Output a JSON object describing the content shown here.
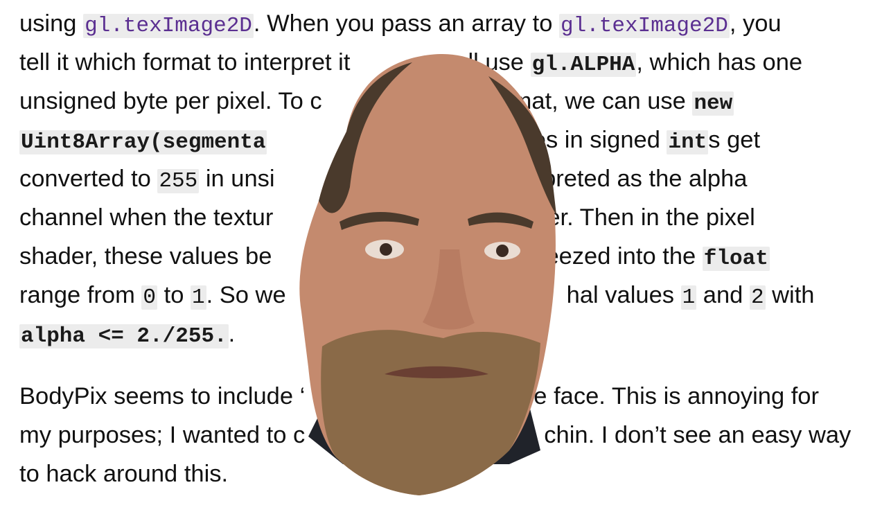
{
  "article": {
    "para1": {
      "l1": {
        "t1": "using ",
        "c1": "gl.texImage2D",
        "t2": ". When you pass an array to ",
        "c2": "gl.texImage2D",
        "t3": ", you"
      },
      "l2": {
        "t1": "tell it which format to interpret it",
        "t2": "ll use ",
        "c1": "gl.ALPHA",
        "t3": ", which has one"
      },
      "l3": {
        "t1": "unsigned byte per pixel. To c",
        "t2": "mat, we can use ",
        "c1": "new"
      },
      "l4": {
        "c1": "Uint8Array(segmenta",
        "t1": "values in signed ",
        "c2": "int",
        "t2": "s get"
      },
      "l5": {
        "t1": "converted to ",
        "c1": "255",
        "t2": " in unsi",
        "t3": "rpreted as the alpha"
      },
      "l6": {
        "t1": "channel when the textur",
        "t2": "er. Then in the pixel"
      },
      "l7": {
        "t1": "shader, these values be",
        "t2": "eezed into the ",
        "c1": "float"
      },
      "l8": {
        "t1": "range from ",
        "c1": "0",
        "t2": " to ",
        "c2": "1",
        "t3": ". So we",
        "t4": "hal values ",
        "c3": "1",
        "t5": " and ",
        "c4": "2",
        "t6": " with"
      },
      "l9": {
        "c1": "alpha <= 2./255.",
        "t1": "."
      }
    },
    "para2": {
      "l1": {
        "t1": "BodyPix seems to include ‘",
        "t2": "e face. This is annoying for"
      },
      "l2": {
        "t1": "my purposes; I wanted to c",
        "t2": "chin. I don’t see an easy way"
      },
      "l3": {
        "t1": "to hack around this."
      }
    }
  },
  "face_image": {
    "subject": "segmented face photo",
    "skin_color": "#c48a6e",
    "hair_color": "#4a3a2c",
    "beard_color": "#8a6a48",
    "shirt_color": "#20232a"
  }
}
